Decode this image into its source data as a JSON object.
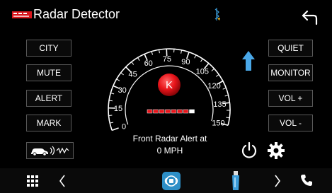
{
  "header": {
    "logo_text": "KENWOOD",
    "title": "Radar Detector"
  },
  "left_buttons": [
    "CITY",
    "MUTE",
    "ALERT",
    "MARK"
  ],
  "right_buttons": [
    "QUIET",
    "MONITOR",
    "VOL +",
    "VOL -"
  ],
  "gauge": {
    "ticks": [
      "0",
      "15",
      "30",
      "45",
      "60",
      "75",
      "90",
      "105",
      "120",
      "135",
      "150"
    ],
    "center_label": "K",
    "center_color": "#e8141a",
    "signal_bars": 8,
    "speed_mph": 0
  },
  "alert": {
    "line1": "Front Radar Alert at",
    "line2": "0 MPH"
  },
  "icons": {
    "back": "back-arrow-icon",
    "bluetooth": "bluetooth-icon",
    "direction": "up-arrow-icon",
    "power": "power-icon",
    "settings": "gear-icon",
    "car_radar": "car-radar-icon"
  },
  "bottom_bar": {
    "items": [
      "apps-grid-icon",
      "chevron-left-icon",
      "radar-app-icon",
      "usb-drive-icon",
      "chevron-right-icon",
      "phone-icon"
    ]
  },
  "colors": {
    "accent_blue": "#3a9bd8",
    "alert_red": "#e8141a",
    "button_border": "#5a5a5a"
  }
}
